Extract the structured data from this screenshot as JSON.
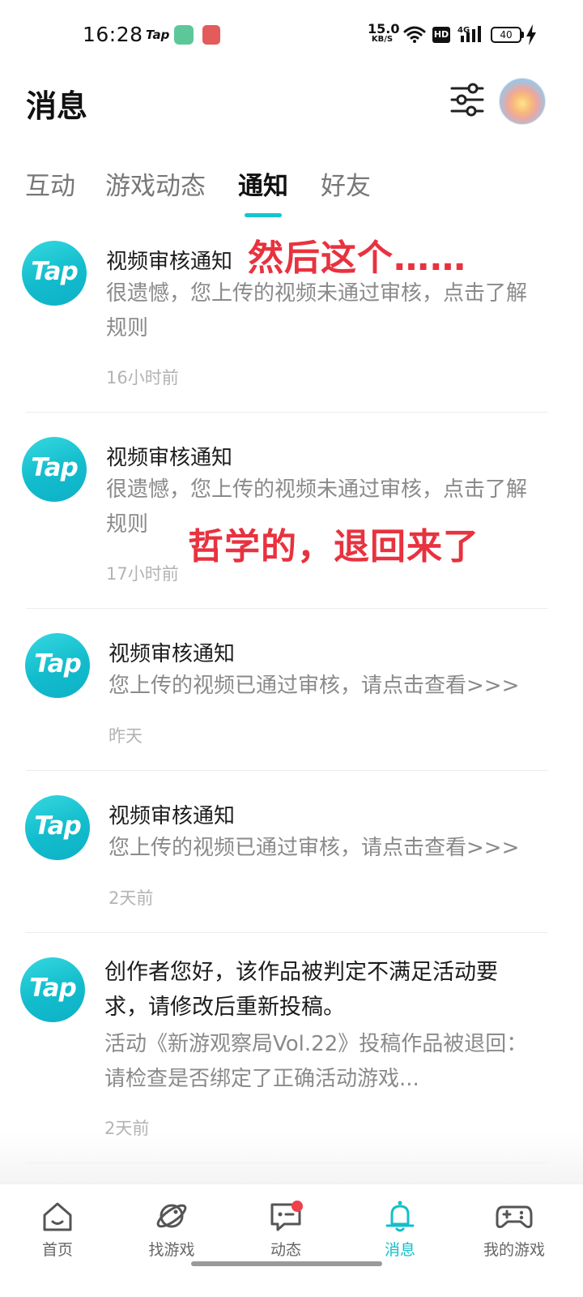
{
  "status_bar": {
    "time": "16:28",
    "tap_label": "Tap",
    "speed_value": "15.0",
    "speed_unit": "KB/S",
    "hd_label": "HD",
    "network": "4G",
    "battery": "40"
  },
  "header": {
    "title": "消息",
    "filter_icon": "sliders-icon",
    "avatar_icon": "avatar"
  },
  "tabs": [
    {
      "label": "互动",
      "active": false
    },
    {
      "label": "游戏动态",
      "active": false
    },
    {
      "label": "通知",
      "active": true
    },
    {
      "label": "好友",
      "active": false
    }
  ],
  "notifications": [
    {
      "logo": "Tap",
      "title": "视频审核通知",
      "body": "很遗憾，您上传的视频未通过审核，点击了解规则",
      "time": "16小时前"
    },
    {
      "logo": "Tap",
      "title": "视频审核通知",
      "body": "很遗憾，您上传的视频未通过审核，点击了解规则",
      "time": "17小时前"
    },
    {
      "logo": "Tap",
      "title": "视频审核通知",
      "body": "您上传的视频已通过审核，请点击查看>>>",
      "time": "昨天"
    },
    {
      "logo": "Tap",
      "title": "视频审核通知",
      "body": "您上传的视频已通过审核，请点击查看>>>",
      "time": "2天前"
    },
    {
      "logo": "Tap",
      "title": "创作者您好，该作品被判定不满足活动要求，请修改后重新投稿。",
      "body": "活动《新游观察局Vol.22》投稿作品被退回：请检查是否绑定了正确活动游戏...",
      "time": "2天前"
    }
  ],
  "annotations": {
    "first": "然后这个……",
    "second": "哲学的，退回来了"
  },
  "bottom_nav": [
    {
      "label": "首页",
      "icon": "home-icon",
      "active": false
    },
    {
      "label": "找游戏",
      "icon": "planet-icon",
      "active": false
    },
    {
      "label": "动态",
      "icon": "chat-icon",
      "active": false,
      "badge": true
    },
    {
      "label": "消息",
      "icon": "bell-icon",
      "active": true
    },
    {
      "label": "我的游戏",
      "icon": "gamepad-icon",
      "active": false
    }
  ],
  "colors": {
    "accent": "#15c5ce",
    "annotation_red": "#e8323f",
    "badge_red": "#f0404a"
  }
}
